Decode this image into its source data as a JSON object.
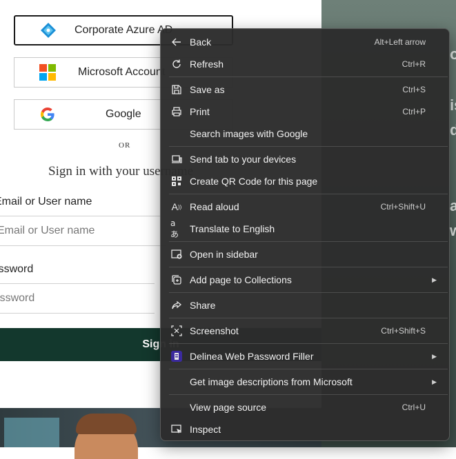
{
  "login": {
    "buttons": [
      {
        "label": "Corporate Azure AD",
        "icon": "azure-ad-icon"
      },
      {
        "label": "Microsoft Account",
        "icon": "microsoft-icon"
      },
      {
        "label": "Google",
        "icon": "google-icon"
      }
    ],
    "or_text": "OR",
    "signin_title": "Sign in with your username",
    "username_label": "Email or User name",
    "username_placeholder": "Email or User name",
    "password_label": "Password",
    "password_placeholder": "Password",
    "signin_button": "Sign in"
  },
  "background_text": [
    "o",
    "is",
    "d",
    "a",
    "w"
  ],
  "context_menu": {
    "items": [
      {
        "label": "Back",
        "shortcut": "Alt+Left arrow",
        "icon": "back-arrow-icon"
      },
      {
        "label": "Refresh",
        "shortcut": "Ctrl+R",
        "icon": "refresh-icon"
      },
      {
        "label": "Save as",
        "shortcut": "Ctrl+S",
        "icon": "save-icon"
      },
      {
        "label": "Print",
        "shortcut": "Ctrl+P",
        "icon": "print-icon"
      },
      {
        "label": "Search images with Google",
        "shortcut": "",
        "icon": ""
      },
      {
        "label": "Send tab to your devices",
        "shortcut": "",
        "icon": "send-tab-icon"
      },
      {
        "label": "Create QR Code for this page",
        "shortcut": "",
        "icon": "qr-code-icon"
      },
      {
        "label": "Read aloud",
        "shortcut": "Ctrl+Shift+U",
        "icon": "read-aloud-icon"
      },
      {
        "label": "Translate to English",
        "shortcut": "",
        "icon": "translate-icon"
      },
      {
        "label": "Open in sidebar",
        "shortcut": "",
        "icon": "open-sidebar-icon"
      },
      {
        "label": "Add page to Collections",
        "shortcut": "",
        "icon": "collections-icon",
        "submenu": true
      },
      {
        "label": "Share",
        "shortcut": "",
        "icon": "share-icon"
      },
      {
        "label": "Screenshot",
        "shortcut": "Ctrl+Shift+S",
        "icon": "screenshot-icon"
      },
      {
        "label": "Delinea Web Password Filler",
        "shortcut": "",
        "icon": "delinea-extension-icon",
        "submenu": true
      },
      {
        "label": "Get image descriptions from Microsoft",
        "shortcut": "",
        "icon": "",
        "submenu": true
      },
      {
        "label": "View page source",
        "shortcut": "Ctrl+U",
        "icon": ""
      },
      {
        "label": "Inspect",
        "shortcut": "",
        "icon": "inspect-icon"
      }
    ]
  },
  "colors": {
    "menu_bg": "#2c2c2c",
    "signin_bg": "#13382d",
    "azure_blue": "#1b8fd6"
  }
}
